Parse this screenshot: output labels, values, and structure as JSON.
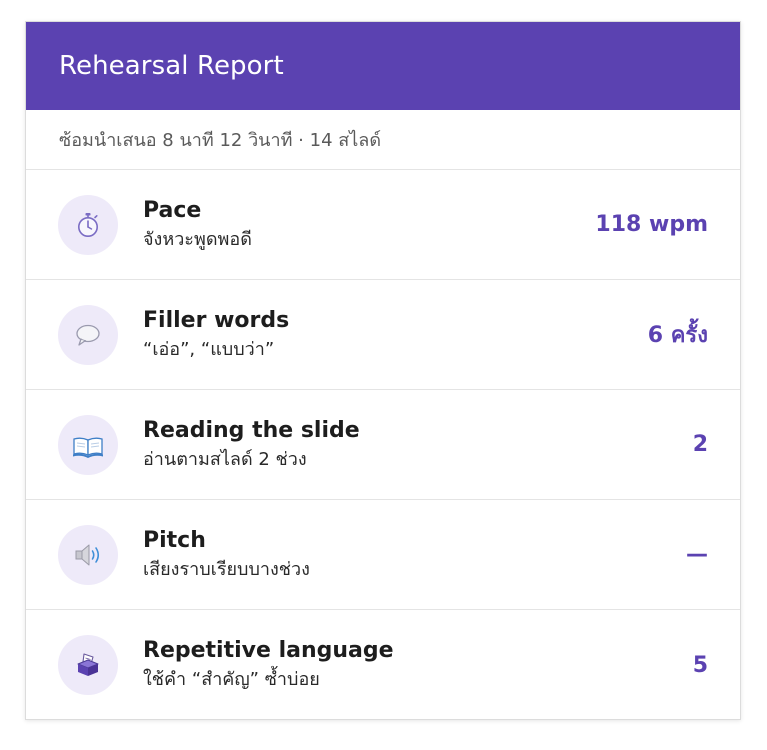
{
  "header": {
    "title": "Rehearsal Report"
  },
  "summary": {
    "text": "ซ้อมนำเสนอ 8 นาที 12 วินาที · 14 สไลด์"
  },
  "metrics": [
    {
      "title": "Pace",
      "description": "จังหวะพูดพอดี",
      "value": "118 wpm",
      "icon": "stopwatch-icon"
    },
    {
      "title": "Filler words",
      "description": "“เอ่อ”, “แบบว่า”",
      "value": "6 ครั้ง",
      "icon": "speech-bubble-icon"
    },
    {
      "title": "Reading the slide",
      "description": "อ่านตามสไลด์ 2 ช่วง",
      "value": "2",
      "icon": "open-book-icon"
    },
    {
      "title": "Pitch",
      "description": "เสียงราบเรียบบางช่วง",
      "value": "—",
      "icon": "speaker-icon"
    },
    {
      "title": "Repetitive language",
      "description": "ใช้คำ “สำคัญ” ซ้ำบ่อย",
      "value": "5",
      "icon": "ballot-box-icon"
    }
  ],
  "colors": {
    "accent": "#5b42b1",
    "icon_background": "#eeeaf9"
  }
}
